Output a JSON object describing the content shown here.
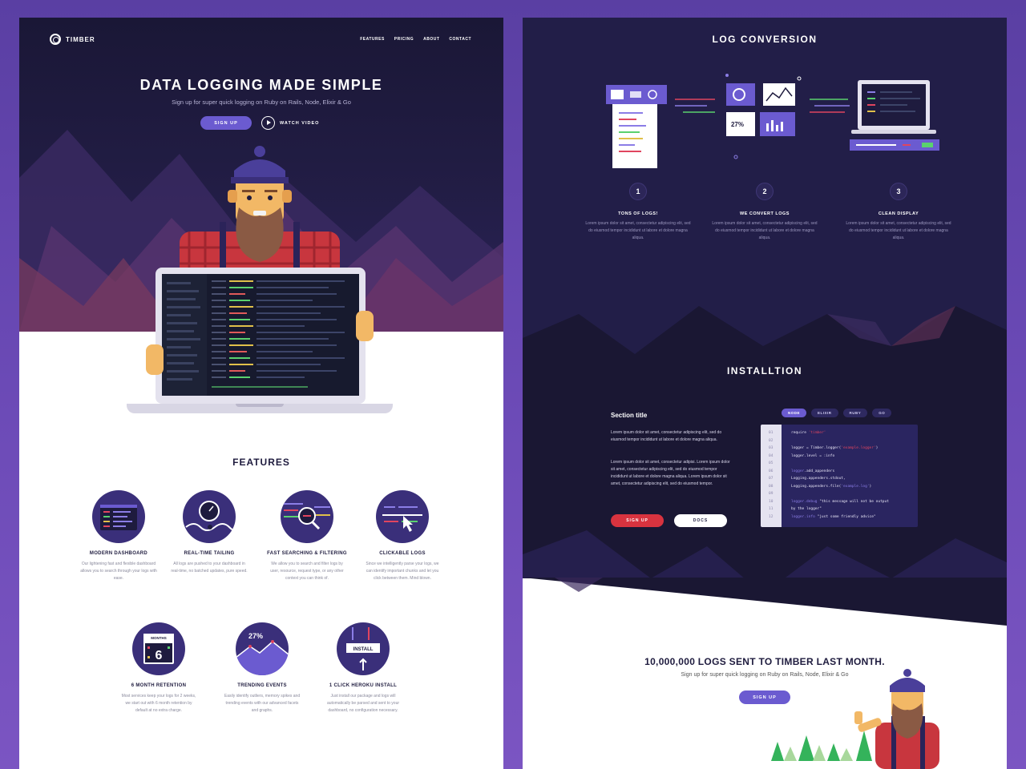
{
  "left": {
    "nav": {
      "brand": "TIMBER",
      "links": [
        "FEATURES",
        "PRICING",
        "ABOUT",
        "CONTACT"
      ]
    },
    "hero": {
      "title": "DATA LOGGING MADE SIMPLE",
      "subtitle": "Sign up for super quick logging on Ruby on Rails, Node, Elixir & Go",
      "signup_label": "SIGN UP",
      "watch_label": "WATCH VIDEO"
    },
    "features": {
      "title": "FEATURES",
      "items": [
        {
          "name": "MODERN DASHBOARD",
          "desc": "Our lightening fast and flexible dashboard allows you to search through your logs with ease.",
          "icon": "dashboard-icon"
        },
        {
          "name": "REAL-TIME TAILING",
          "desc": "All logs are pushed to your dashboard in real-time, no batched updates, pure speed.",
          "icon": "clock-icon"
        },
        {
          "name": "FAST SEARCHING & FILTERING",
          "desc": "We allow you to search and filter logs by user, resource, request type, or any other context you can think of.",
          "icon": "search-icon"
        },
        {
          "name": "CLICKABLE LOGS",
          "desc": "Since we intelligently parse your logs, we can identify important chunks and let you click between them. Mind blown.",
          "icon": "cursor-icon"
        },
        {
          "name": "6 MONTH RETENTION",
          "desc": "Most services keep your logs for 2 weeks, we start out with 6 month retention by default at no extra charge.",
          "icon": "calendar-icon",
          "badge": "MONTHS",
          "badge_value": "6"
        },
        {
          "name": "TRENDING EVENTS",
          "desc": "Easily identify outliers, memory spikes and trending events with our advanced facets and graphs.",
          "icon": "trend-icon",
          "badge_value": "27%"
        },
        {
          "name": "1 CLICK HEROKU INSTALL",
          "desc": "Just install our package and logs will automatically be parsed and sent to your dashboard, no configuration necessary.",
          "icon": "install-icon",
          "badge": "INSTALL"
        }
      ]
    }
  },
  "right": {
    "conversion": {
      "title": "LOG CONVERSION",
      "badge_value": "27%",
      "steps": [
        {
          "num": "1",
          "name": "TONS OF LOGS!",
          "desc": "Lorem ipsum dolor sit amet, consectetur adipiscing elit, sed do eiusmod tempor incididunt ut labore et dolore magna aliqua."
        },
        {
          "num": "2",
          "name": "WE CONVERT LOGS",
          "desc": "Lorem ipsum dolor sit amet, consectetur adipiscing elit, sed do eiusmod tempor incididunt ut labore et dolore magna aliqua."
        },
        {
          "num": "3",
          "name": "CLEAN DISPLAY",
          "desc": "Lorem ipsum dolor sit amet, consectetur adipiscing elit, sed do eiusmod tempor incididunt ut labore et dolore magna aliqua."
        }
      ]
    },
    "install": {
      "title": "INSTALLTION",
      "section_title": "Section title",
      "para1": "Lorem ipsum dolor sit amet, consectetur adipiscing elit, sed do eiusmod tempor incididunt ut labore et dolore magna aliqua.",
      "para2": "Lorem ipsum dolor sit amet, consectetur adipisi. Lorem ipsum dolor sit amet, consectetur adipiscing elit, sed do eiusmod tempor incididunt ut labore et dolore magna aliqua. Lorem ipsum dolor sit amet, consectetur adipiscing elit, sed do eiusmod tempor.",
      "signup_label": "SIGN UP",
      "docs_label": "DOCS",
      "tabs": [
        "NODE",
        "ELIXIR",
        "RUBY",
        "GO"
      ],
      "active_tab": "NODE",
      "code": [
        {
          "n": "01",
          "parts": [
            {
              "t": "require ",
              "c": "#e8e6f6"
            },
            {
              "t": "'timber'",
              "c": "#e0455f"
            }
          ]
        },
        {
          "n": "02",
          "parts": []
        },
        {
          "n": "03",
          "parts": [
            {
              "t": "logger = Timber.logger(",
              "c": "#e8e6f6"
            },
            {
              "t": "'example.logger'",
              "c": "#e0455f"
            },
            {
              "t": ")",
              "c": "#e8e6f6"
            }
          ]
        },
        {
          "n": "04",
          "parts": [
            {
              "t": "logger.level = :info",
              "c": "#e8e6f6"
            }
          ]
        },
        {
          "n": "05",
          "parts": []
        },
        {
          "n": "06",
          "parts": [
            {
              "t": "logger",
              "c": "#8b7de6"
            },
            {
              "t": ".add_appenders",
              "c": "#e8e6f6"
            }
          ]
        },
        {
          "n": "07",
          "parts": [
            {
              "t": "Logging.appenders.stdout,",
              "c": "#e8e6f6"
            }
          ]
        },
        {
          "n": "08",
          "parts": [
            {
              "t": "Logging.appenders.file(",
              "c": "#e8e6f6"
            },
            {
              "t": "'example.log'",
              "c": "#8b7de6"
            },
            {
              "t": ")",
              "c": "#e8e6f6"
            }
          ]
        },
        {
          "n": "09",
          "parts": []
        },
        {
          "n": "10",
          "parts": [
            {
              "t": "logger.debug ",
              "c": "#8b7de6"
            },
            {
              "t": "\"this message will not be output",
              "c": "#e8e6f6"
            }
          ]
        },
        {
          "n": "11",
          "parts": [
            {
              "t": "by the logger\"",
              "c": "#e8e6f6"
            }
          ]
        },
        {
          "n": "12",
          "parts": [
            {
              "t": "logger.info ",
              "c": "#8b7de6"
            },
            {
              "t": "\"just some friendly advice\"",
              "c": "#e8e6f6"
            }
          ]
        }
      ]
    },
    "stats": {
      "title": "10,000,000 LOGS SENT TO TIMBER LAST MONTH.",
      "subtitle": "Sign up for super quick logging on Ruby on Rails, Node, Elixir & Go",
      "signup_label": "SIGN UP"
    }
  },
  "colors": {
    "bg_purple": "#6b4ab6",
    "dark_navy": "#1e1b3e",
    "accent_purple": "#6b5bd0",
    "accent_red": "#e0455f"
  }
}
